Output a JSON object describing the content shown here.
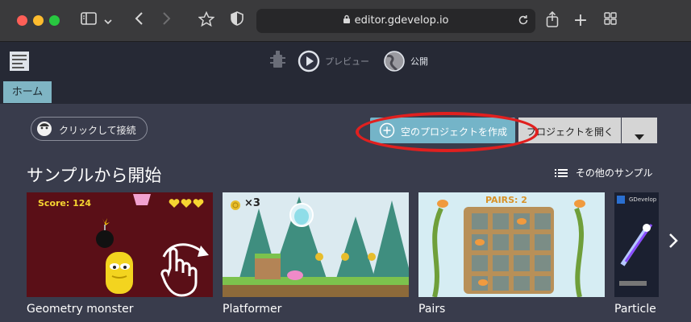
{
  "browser": {
    "url": "editor.gdevelop.io",
    "icons": [
      "sidebar-icon",
      "chevron-down-icon",
      "back-icon",
      "forward-icon",
      "star-icon",
      "shield-icon",
      "lock-icon",
      "reload-icon",
      "share-icon",
      "new-tab-icon",
      "tabs-grid-icon"
    ]
  },
  "toolbar": {
    "preview_label": "プレビュー",
    "publish_label": "公開"
  },
  "tabs": [
    {
      "label": "ホーム"
    }
  ],
  "home": {
    "connect_label": "クリックして接続",
    "create_label": "空のプロジェクトを作成",
    "open_label": "プロジェクトを開く",
    "section_title": "サンプルから開始",
    "more_samples_label": "その他のサンプル",
    "samples": [
      {
        "title": "Geometry monster",
        "thumb_score": "Score: 124"
      },
      {
        "title": "Platformer",
        "thumb_count": "×3"
      },
      {
        "title": "Pairs",
        "thumb_text": "PAIRS: 2"
      },
      {
        "title": "Particle",
        "thumb_text": "GDevelop Pa"
      }
    ]
  },
  "colors": {
    "accent": "#74b4c8",
    "highlight_ring": "#e0201f",
    "background": "#393c4c"
  }
}
